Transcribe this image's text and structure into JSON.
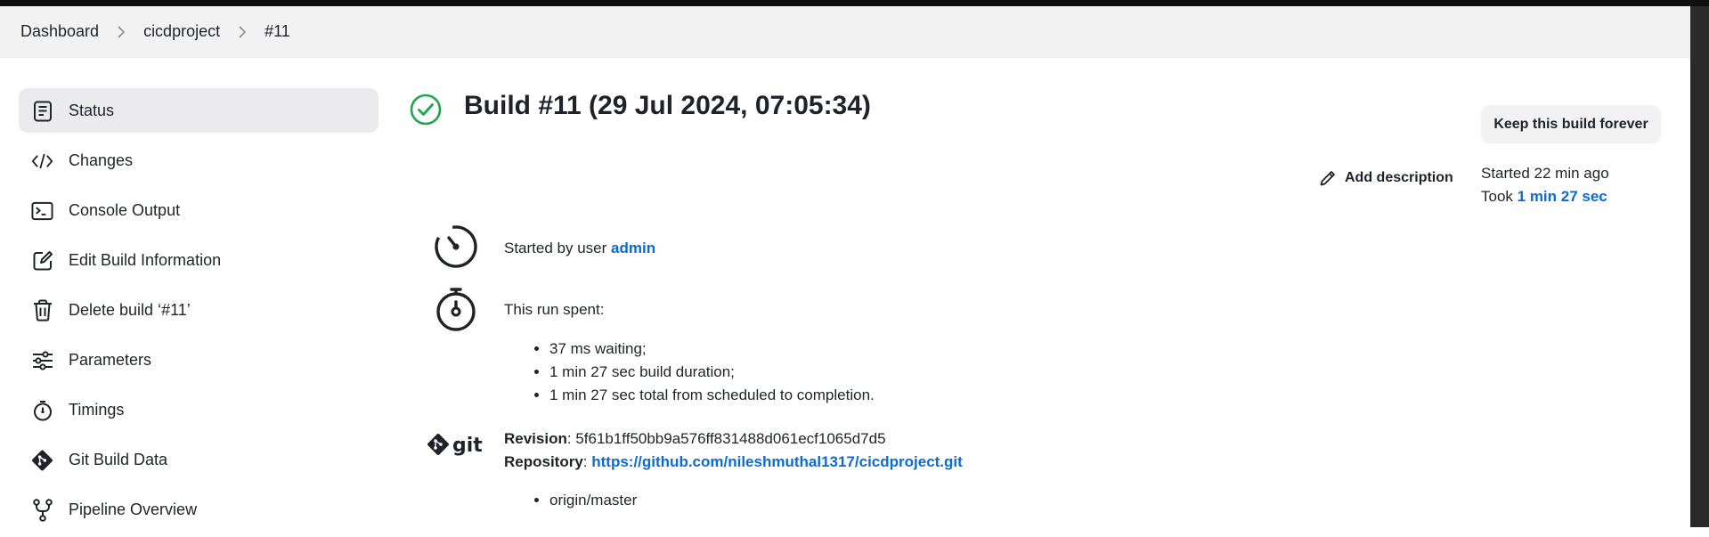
{
  "breadcrumb": {
    "items": [
      "Dashboard",
      "cicdproject",
      "#11"
    ]
  },
  "sidebar": {
    "items": [
      {
        "label": "Status",
        "icon": "document-icon",
        "active": true
      },
      {
        "label": "Changes",
        "icon": "code-icon"
      },
      {
        "label": "Console Output",
        "icon": "terminal-icon"
      },
      {
        "label": "Edit Build Information",
        "icon": "edit-icon"
      },
      {
        "label": "Delete build ‘#11’",
        "icon": "trash-icon"
      },
      {
        "label": "Parameters",
        "icon": "sliders-icon"
      },
      {
        "label": "Timings",
        "icon": "stopwatch-icon"
      },
      {
        "label": "Git Build Data",
        "icon": "git-icon"
      },
      {
        "label": "Pipeline Overview",
        "icon": "pipeline-icon"
      }
    ]
  },
  "build": {
    "title": "Build #11 (29 Jul 2024, 07:05:34)",
    "status_icon": "success-check-icon",
    "keep_label": "Keep this build forever",
    "add_description_label": "Add description",
    "started_label": "Started 22 min ago",
    "took_prefix": "Took ",
    "took_value": "1 min 27 sec"
  },
  "cause": {
    "prefix": "Started by user ",
    "user": "admin"
  },
  "run_spent": {
    "heading": "This run spent:",
    "items": [
      "37 ms waiting;",
      "1 min 27 sec build duration;",
      "1 min 27 sec total from scheduled to completion."
    ]
  },
  "git": {
    "revision_label": "Revision",
    "revision_value": "5f61b1ff50bb9a576ff831488d061ecf1065d7d5",
    "repository_label": "Repository",
    "repository_value": "https://github.com/nileshmuthal1317/cicdproject.git",
    "branches": [
      "origin/master"
    ]
  },
  "colors": {
    "accent": "#0b6bd6",
    "success": "#1ea64a",
    "text": "#1f2329"
  }
}
